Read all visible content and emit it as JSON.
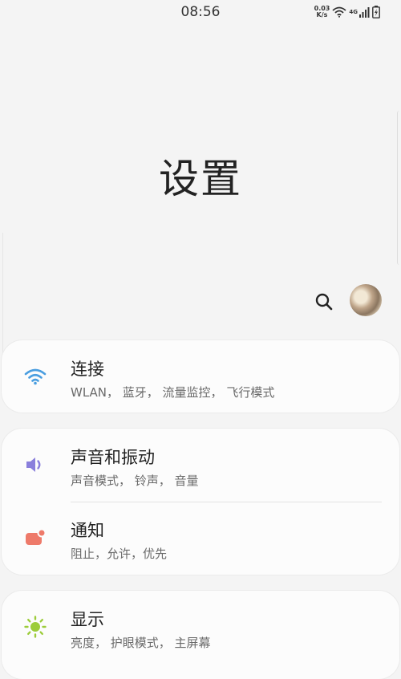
{
  "status_bar": {
    "time": "08:56",
    "net_speed_value": "0.03",
    "net_speed_unit": "K/s",
    "network_type": "4G"
  },
  "page": {
    "title": "设置"
  },
  "settings": [
    {
      "title": "连接",
      "subtitle": "WLAN， 蓝牙， 流量监控， 飞行模式",
      "icon": "wifi-icon",
      "color": "#4a9ee0"
    },
    {
      "title": "声音和振动",
      "subtitle": "声音模式， 铃声， 音量",
      "icon": "speaker-icon",
      "color": "#8a7fdc"
    },
    {
      "title": "通知",
      "subtitle": "阻止，允许，优先",
      "icon": "notification-icon",
      "color": "#ee7a6a"
    },
    {
      "title": "显示",
      "subtitle": "亮度， 护眼模式， 主屏幕",
      "icon": "brightness-icon",
      "color": "#9ccc3a"
    }
  ]
}
